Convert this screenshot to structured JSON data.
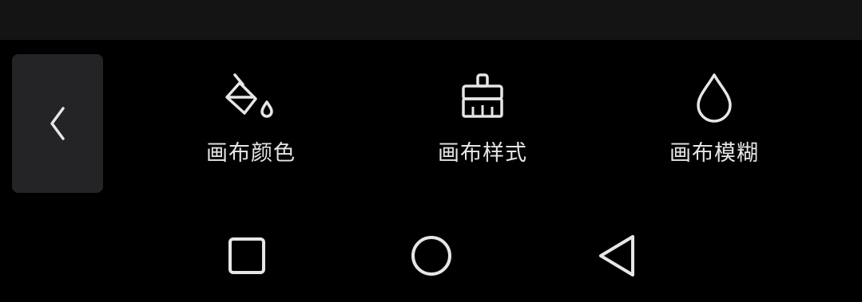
{
  "toolbar": {
    "back_icon": "chevron-left-icon",
    "items": [
      {
        "label": "画布颜色",
        "icon": "paint-bucket-icon"
      },
      {
        "label": "画布样式",
        "icon": "brush-icon"
      },
      {
        "label": "画布模糊",
        "icon": "droplet-icon"
      }
    ]
  },
  "navbar": {
    "buttons": [
      {
        "icon": "square-recents-icon"
      },
      {
        "icon": "circle-home-icon"
      },
      {
        "icon": "triangle-back-icon"
      }
    ]
  },
  "colors": {
    "background": "#000000",
    "top_strip": "#141414",
    "back_button_bg": "#242426",
    "icon_stroke": "#e6e6e6",
    "label_text": "#e6e6e6"
  }
}
